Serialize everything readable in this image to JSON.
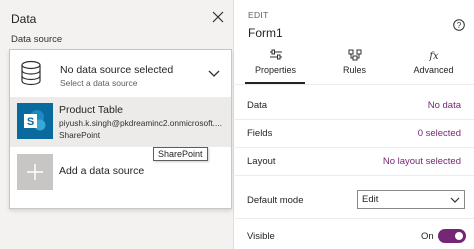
{
  "data_pane": {
    "title": "Data",
    "source_label": "Data source",
    "dropdown": {
      "main": "No data source selected",
      "sub": "Select a data source"
    },
    "items": [
      {
        "name": "Product Table",
        "email": "piyush.k.singh@pkdreaminc2.onmicrosoft....",
        "kind": "SharePoint",
        "selected": true
      }
    ],
    "add_label": "Add a data source",
    "tooltip": "SharePoint"
  },
  "props": {
    "section": "EDIT",
    "form_name": "Form1",
    "tabs": [
      {
        "label": "Properties",
        "icon": "properties-icon",
        "active": true
      },
      {
        "label": "Rules",
        "icon": "rules-icon",
        "active": false
      },
      {
        "label": "Advanced",
        "icon": "fx-icon",
        "active": false
      }
    ],
    "rows": {
      "data": {
        "label": "Data",
        "value": "No data"
      },
      "fields": {
        "label": "Fields",
        "value": "0 selected"
      },
      "layout": {
        "label": "Layout",
        "value": "No layout selected"
      },
      "default_mode": {
        "label": "Default mode",
        "value": "Edit"
      },
      "visible": {
        "label": "Visible",
        "value": "On",
        "on": true
      }
    }
  },
  "colors": {
    "accent": "#742774",
    "sharepoint_tile": "#0b6a9d",
    "pane_bg": "#f3f2f1"
  }
}
